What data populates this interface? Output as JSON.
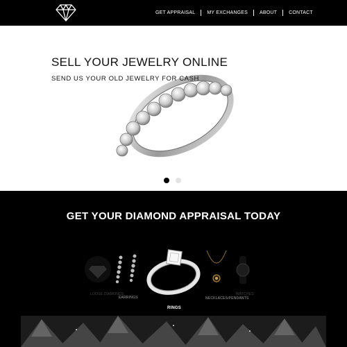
{
  "header": {
    "logo_icon": "diamond-icon",
    "nav": [
      {
        "label": "GET APPRAISAL"
      },
      {
        "label": "MY EXCHANGES"
      },
      {
        "label": "ABOUT"
      },
      {
        "label": "CONTACT"
      }
    ]
  },
  "hero": {
    "title": "SELL YOUR JEWELRY ONLINE",
    "subtitle": "SEND US YOUR OLD JEWELRY FOR CASH",
    "slide_count": 2,
    "active_slide": 1
  },
  "appraisal": {
    "title": "GET YOUR DIAMOND APPRAISAL TODAY",
    "categories": [
      {
        "label": "LOOSE DIAMONDS",
        "icon": "loose-diamonds-image"
      },
      {
        "label": "EARRINGS",
        "icon": "earrings-image"
      },
      {
        "label": "RINGS",
        "icon": "ring-image"
      },
      {
        "label": "NECKLACES/PENDANTS",
        "icon": "necklace-image"
      },
      {
        "label": "WATCHES",
        "icon": "watch-image"
      }
    ],
    "selected": "RINGS"
  },
  "colors": {
    "background": "#000000",
    "hero_background": "#ffffff",
    "text_light": "#ffffff",
    "text_dark": "#111111"
  }
}
